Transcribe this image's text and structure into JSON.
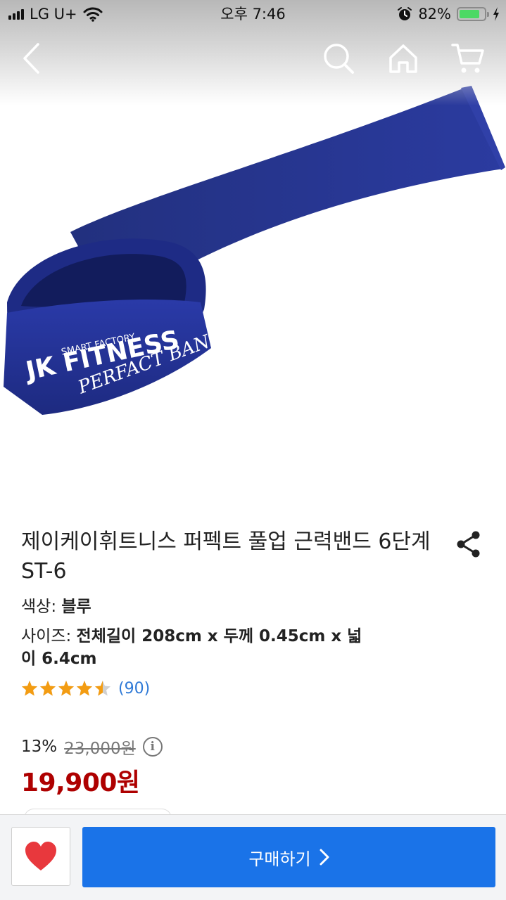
{
  "status_bar": {
    "carrier": "LG U+",
    "time": "오후 7:46",
    "battery": "82%",
    "battery_level": 0.82
  },
  "header": {
    "icons": [
      "back-icon",
      "search-icon",
      "home-icon",
      "cart-icon"
    ]
  },
  "product": {
    "image": {
      "brand_small": "SMART FACTORY",
      "brand_main": "JK FITNESS",
      "script_text": "PERFACT BAND"
    },
    "title": "제이케이휘트니스 퍼펙트 풀업 근력밴드 6단계 ST-6",
    "color_label": "색상: ",
    "color_value": "블루",
    "size_label": "사이즈: ",
    "size_value_line1": "전체길이 208cm x 두께 0.45cm x  넓",
    "size_value_line2": "이 6.4cm",
    "rating": 4.5,
    "review_count": "(90)",
    "discount_rate": "13%",
    "original_price": "23,000원",
    "sale_price": "19,900원"
  },
  "bottom_bar": {
    "buy_label": "구매하기"
  },
  "colors": {
    "accent": "#1a73e8",
    "price": "#ae0000",
    "star": "#f39c12",
    "wish": "#e8383d",
    "link": "#2e79d6"
  }
}
